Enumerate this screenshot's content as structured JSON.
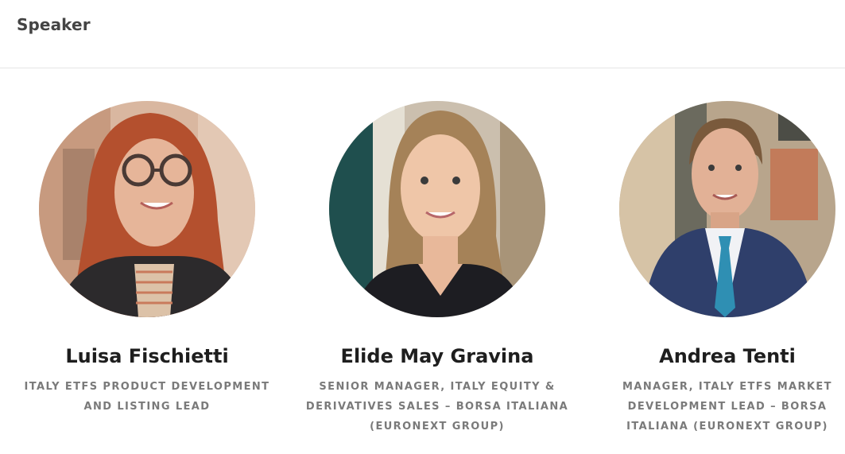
{
  "section": {
    "title": "Speaker"
  },
  "speakers": [
    {
      "name": "Luisa Fischietti",
      "role": "ITALY ETFS PRODUCT DEVELOPMENT AND LISTING LEAD"
    },
    {
      "name": "Elide May Gravina",
      "role": "SENIOR MANAGER, ITALY EQUITY & DERIVATIVES SALES – BORSA ITALIANA (EURONEXT GROUP)"
    },
    {
      "name": "Andrea Tenti",
      "role": "MANAGER, ITALY ETFS MARKET DEVELOPMENT LEAD – BORSA ITALIANA (EURONEXT GROUP)"
    }
  ]
}
